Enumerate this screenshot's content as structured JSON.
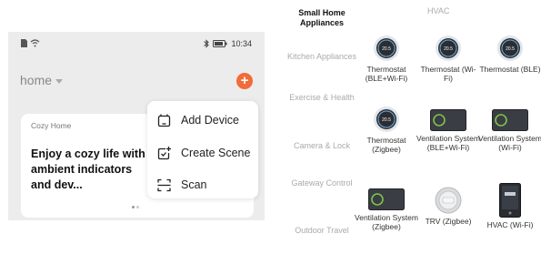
{
  "phone": {
    "status": {
      "time": "10:34"
    },
    "home": {
      "label": "home"
    },
    "card": {
      "small": "Cozy Home",
      "big": "Enjoy a cozy life with ambient indicators and dev..."
    },
    "menu": [
      {
        "label": "Add Device",
        "icon": "add-device-icon"
      },
      {
        "label": "Create Scene",
        "icon": "create-scene-icon"
      },
      {
        "label": "Scan",
        "icon": "scan-icon"
      }
    ]
  },
  "categories": [
    {
      "label": "Small Home Appliances",
      "active": true
    },
    {
      "label": "Kitchen Appliances",
      "active": false
    },
    {
      "label": "Exercise & Health",
      "active": false
    },
    {
      "label": "Camera & Lock",
      "active": false
    },
    {
      "label": "Gateway Control",
      "active": false
    },
    {
      "label": "Outdoor Travel",
      "active": false
    }
  ],
  "section_title": "HVAC",
  "devices": [
    {
      "name": "Thermostat (BLE+Wi-Fi)",
      "icon": "round-thermostat-icon"
    },
    {
      "name": "Thermostat (Wi-Fi)",
      "icon": "round-thermostat-icon"
    },
    {
      "name": "Thermostat (BLE)",
      "icon": "round-thermostat-icon"
    },
    {
      "name": "Thermostat (Zigbee)",
      "icon": "round-thermostat-icon"
    },
    {
      "name": "Ventilation System (BLE+Wi-Fi)",
      "icon": "ventilation-panel-icon"
    },
    {
      "name": "Ventilation System (Wi-Fi)",
      "icon": "ventilation-panel-icon"
    },
    {
      "name": "Ventilation System (Zigbee)",
      "icon": "ventilation-panel-icon"
    },
    {
      "name": "TRV (Zigbee)",
      "icon": "trv-dial-icon"
    },
    {
      "name": "HVAC (Wi-Fi)",
      "icon": "hvac-tall-panel-icon"
    }
  ],
  "colors": {
    "accent": "#f26b3a",
    "ring": "#7ec24a",
    "panel_bg": "#ececec"
  },
  "thermostat_display": "20.5"
}
